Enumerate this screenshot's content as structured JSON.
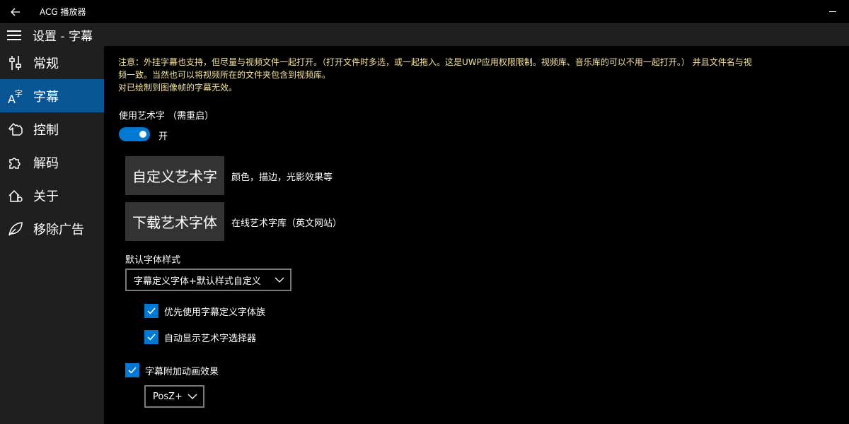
{
  "titlebar": {
    "back_icon": "back-arrow-icon",
    "app_title": "ACG 播放器"
  },
  "header": {
    "title": "设置 - 字幕"
  },
  "sidebar": {
    "items": [
      {
        "label": "常规",
        "icon": "sliders-icon"
      },
      {
        "label": "字幕",
        "icon": "subtitle-icon",
        "active": true
      },
      {
        "label": "控制",
        "icon": "hand-icon"
      },
      {
        "label": "解码",
        "icon": "puzzle-icon"
      },
      {
        "label": "关于",
        "icon": "about-icon"
      },
      {
        "label": "移除广告",
        "icon": "leaf-icon"
      }
    ],
    "active_color": "#0a5694"
  },
  "main": {
    "notice_line1": "注意：外挂字幕也支持，但尽量与视频文件一起打开。（打开文件时多选，或一起拖入。这是UWP应用权限限制。视频库、音乐库的可以不用一起打开。）  并且文件名与视",
    "notice_line2": "频一致。当然也可以将视频所在的文件夹包含到视频库。",
    "notice_line3": "对已绘制到图像帧的字幕无效。",
    "art_font_label": "使用艺术字  （需重启）",
    "toggle_state": "开",
    "custom_art_button": "自定义艺术字",
    "custom_art_desc": "颜色，描边，光影效果等",
    "download_font_button": "下载艺术字体",
    "download_font_desc": "在线艺术字库（英文网站）",
    "default_style_label": "默认字体样式",
    "default_style_value": "字幕定义字体+默认样式自定义",
    "prefer_font_family": "优先使用字幕定义字体族",
    "auto_show_selector": "自动显示艺术字选择器",
    "subtitle_animation": "字幕附加动画效果",
    "animation_value": "PosZ+",
    "accent_color": "#0078d4",
    "notice_color": "#f4e3a0"
  }
}
